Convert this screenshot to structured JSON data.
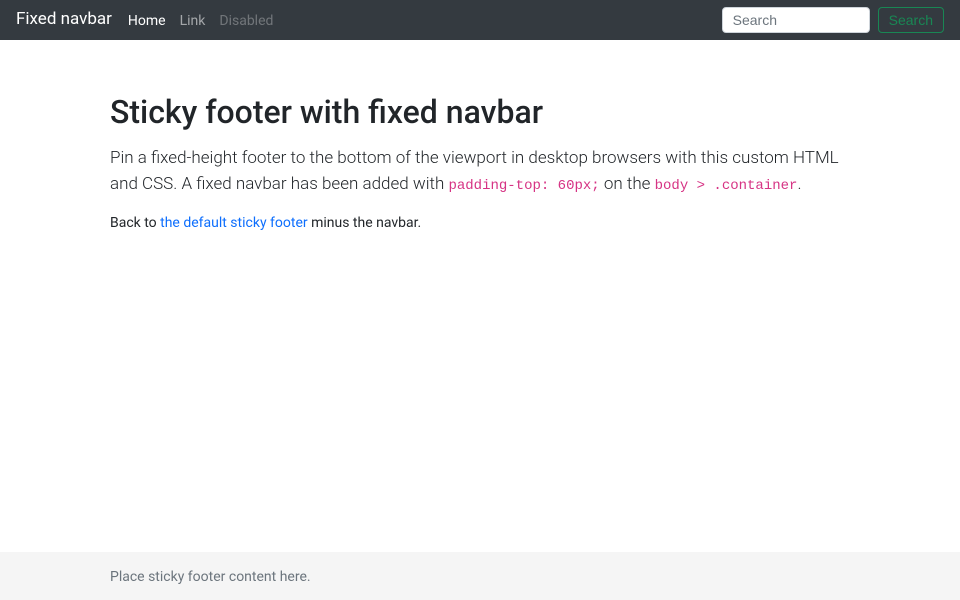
{
  "navbar": {
    "brand": "Fixed navbar",
    "links": [
      {
        "label": "Home",
        "state": "active"
      },
      {
        "label": "Link",
        "state": "normal"
      },
      {
        "label": "Disabled",
        "state": "disabled"
      }
    ],
    "search_placeholder": "Search",
    "search_button": "Search"
  },
  "main": {
    "title": "Sticky footer with fixed navbar",
    "lead_pre": "Pin a fixed-height footer to the bottom of the viewport in desktop browsers with this custom HTML and CSS. A fixed navbar has been added with ",
    "code1": "padding-top: 60px;",
    "lead_mid": " on the ",
    "code2": "body > .container",
    "lead_post": ".",
    "back_pre": "Back to ",
    "back_link": "the default sticky footer",
    "back_post": " minus the navbar."
  },
  "footer": {
    "text": "Place sticky footer content here."
  }
}
